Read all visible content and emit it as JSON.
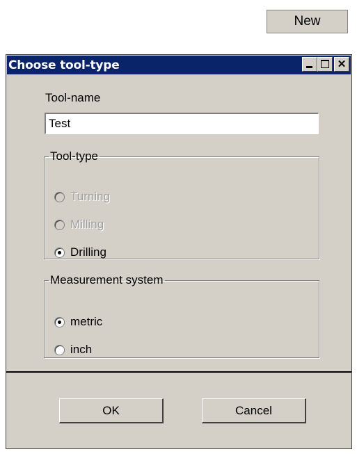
{
  "top_button": {
    "label": "New"
  },
  "dialog": {
    "title": "Choose tool-type",
    "tool_name_label": "Tool-name",
    "tool_name_value": "Test",
    "tool_type": {
      "legend": "Tool-type",
      "options": [
        {
          "label": "Turning",
          "selected": false,
          "enabled": false
        },
        {
          "label": "Milling",
          "selected": false,
          "enabled": false
        },
        {
          "label": "Drilling",
          "selected": true,
          "enabled": true
        }
      ]
    },
    "measurement": {
      "legend": "Measurement system",
      "options": [
        {
          "label": "metric",
          "selected": true,
          "enabled": true
        },
        {
          "label": "inch",
          "selected": false,
          "enabled": true
        }
      ]
    },
    "ok_label": "OK",
    "cancel_label": "Cancel"
  },
  "colors": {
    "titlebar": "#0a246a",
    "face": "#d4d0c8",
    "disabled_text": "#a0a0a0"
  },
  "icons": [
    "minimize-icon",
    "maximize-icon",
    "close-icon"
  ]
}
